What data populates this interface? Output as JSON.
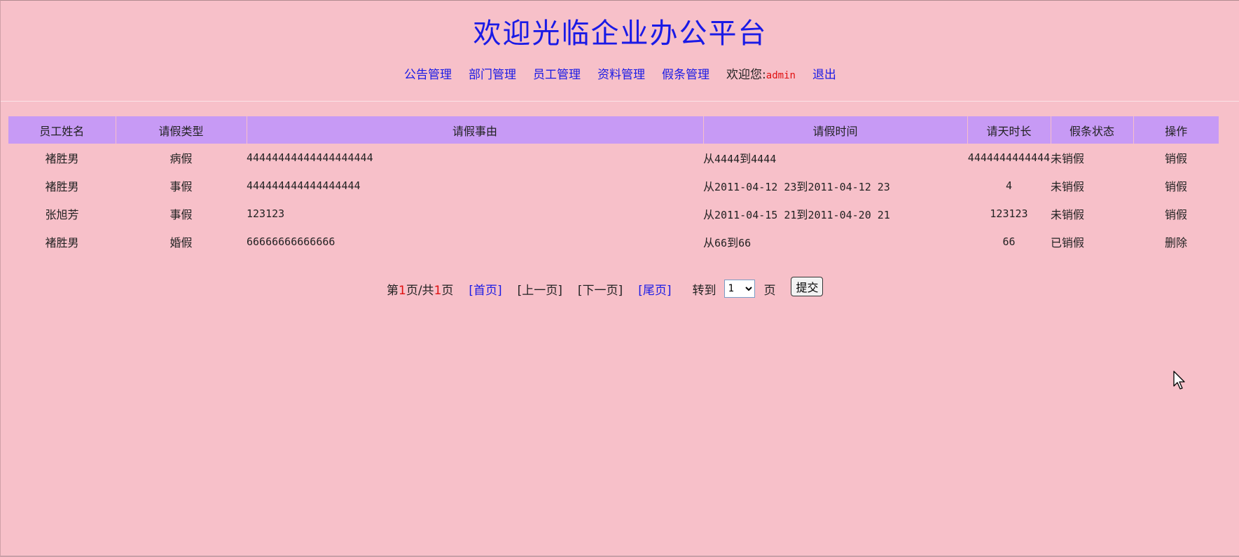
{
  "header": {
    "title": "欢迎光临企业办公平台"
  },
  "nav": {
    "items": [
      "公告管理",
      "部门管理",
      "员工管理",
      "资料管理",
      "假条管理"
    ],
    "welcome_label": "欢迎您:",
    "username": "admin",
    "logout_label": "退出"
  },
  "table": {
    "headers": [
      "员工姓名",
      "请假类型",
      "请假事由",
      "请假时间",
      "请天时长",
      "假条状态",
      "操作"
    ],
    "rows": [
      {
        "name": "褚胜男",
        "type": "病假",
        "reason": "44444444444444444444",
        "time_from_label": "从",
        "time_from": "4444",
        "time_to_label": "到",
        "time_to": "4444",
        "duration": "4444444444444",
        "status": "未销假",
        "action": "销假"
      },
      {
        "name": "褚胜男",
        "type": "事假",
        "reason": "444444444444444444",
        "time_from_label": "从",
        "time_from": "2011-04-12 23",
        "time_to_label": "到",
        "time_to": "2011-04-12 23",
        "duration": "4",
        "status": "未销假",
        "action": "销假"
      },
      {
        "name": "张旭芳",
        "type": "事假",
        "reason": "123123",
        "time_from_label": "从",
        "time_from": "2011-04-15 21",
        "time_to_label": "到",
        "time_to": "2011-04-20 21",
        "duration": "123123",
        "status": "未销假",
        "action": "销假"
      },
      {
        "name": "褚胜男",
        "type": "婚假",
        "reason": "66666666666666",
        "time_from_label": "从",
        "time_from": "66",
        "time_to_label": "到",
        "time_to": "66",
        "duration": "66",
        "status": "已销假",
        "action": "删除"
      }
    ]
  },
  "pager": {
    "page_prefix": "第",
    "current_page": "1",
    "page_mid": "页/共",
    "total_pages": "1",
    "page_suffix": "页",
    "first": "[首页]",
    "prev": "[上一页]",
    "next": "[下一页]",
    "last": "[尾页]",
    "goto_label": "转到",
    "goto_value": "1",
    "page_unit": "页",
    "submit_label": "提交"
  },
  "colors": {
    "background": "#f7c0c9",
    "header_row": "#c79af5",
    "link_blue": "#1a1ae6",
    "alert_red": "#e01010"
  },
  "icons": {
    "cursor": "mouse-pointer-icon"
  }
}
